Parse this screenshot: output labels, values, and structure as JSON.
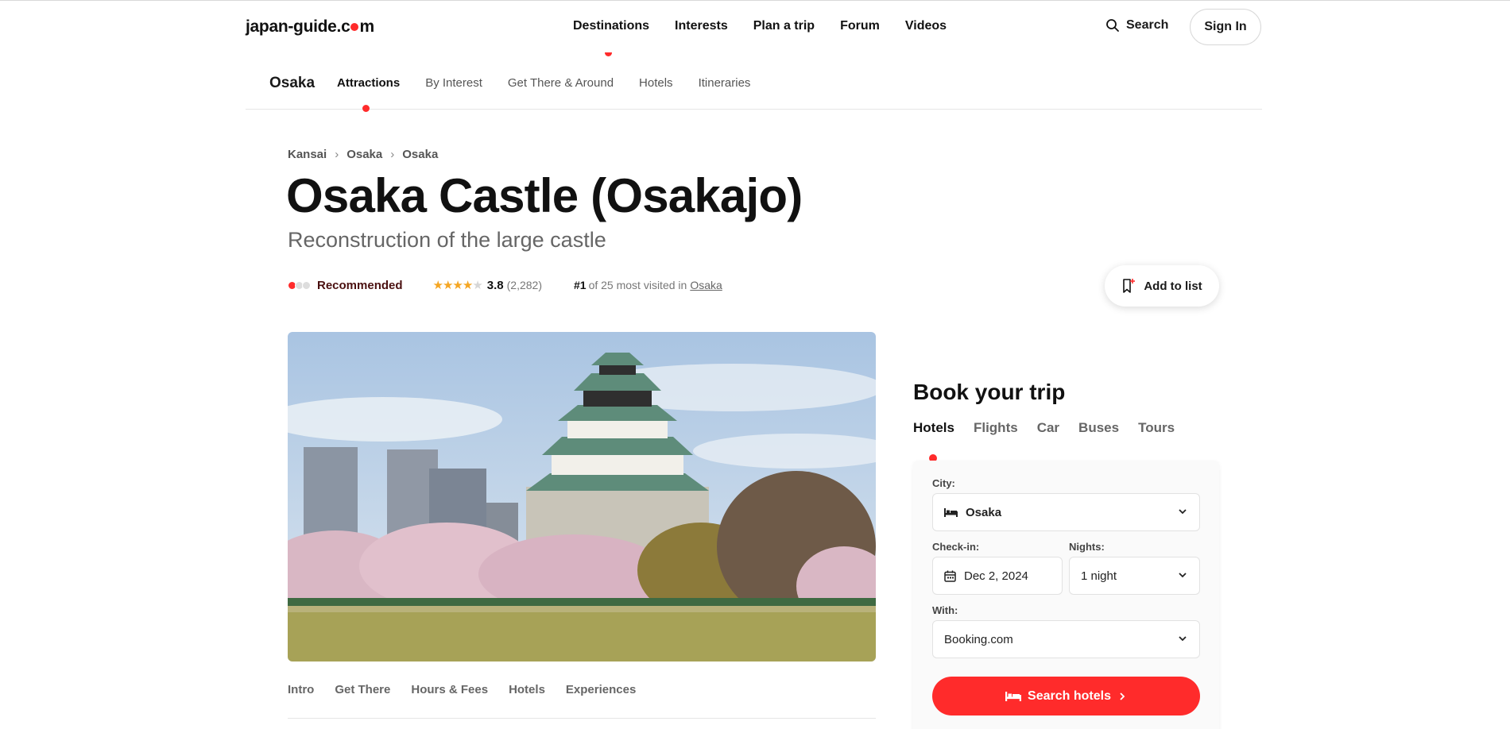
{
  "header": {
    "logo_left": "japan-guide.c",
    "logo_right": "m",
    "nav": [
      "Destinations",
      "Interests",
      "Plan a trip",
      "Forum",
      "Videos"
    ],
    "search_label": "Search",
    "signin_label": "Sign In"
  },
  "subnav": {
    "city": "Osaka",
    "items": [
      "Attractions",
      "By Interest",
      "Get There & Around",
      "Hotels",
      "Itineraries"
    ]
  },
  "breadcrumb": [
    "Kansai",
    "Osaka",
    "Osaka"
  ],
  "breadcrumb_sep": "›",
  "page": {
    "title": "Osaka Castle (Osakajo)",
    "subtitle": "Reconstruction of the large castle"
  },
  "meta": {
    "recommendation": "Recommended",
    "recommendation_level": 1,
    "recommendation_max": 3,
    "rating": "3.8",
    "stars_filled": 4,
    "reviews": "(2,282)",
    "rank": "#1",
    "rank_text": "of 25 most visited in",
    "rank_link": "Osaka"
  },
  "add_to_list_label": "Add to list",
  "content_tabs": [
    "Intro",
    "Get There",
    "Hours & Fees",
    "Hotels",
    "Experiences"
  ],
  "booking": {
    "title": "Book your trip",
    "tabs": [
      "Hotels",
      "Flights",
      "Car",
      "Buses",
      "Tours"
    ],
    "city_label": "City:",
    "city_value": "Osaka",
    "checkin_label": "Check-in:",
    "checkin_value": "Dec 2, 2024",
    "nights_label": "Nights:",
    "nights_value": "1 night",
    "with_label": "With:",
    "with_value": "Booking.com",
    "search_button": "Search hotels"
  },
  "colors": {
    "accent": "#ff2b2b",
    "star": "#f5a623"
  }
}
